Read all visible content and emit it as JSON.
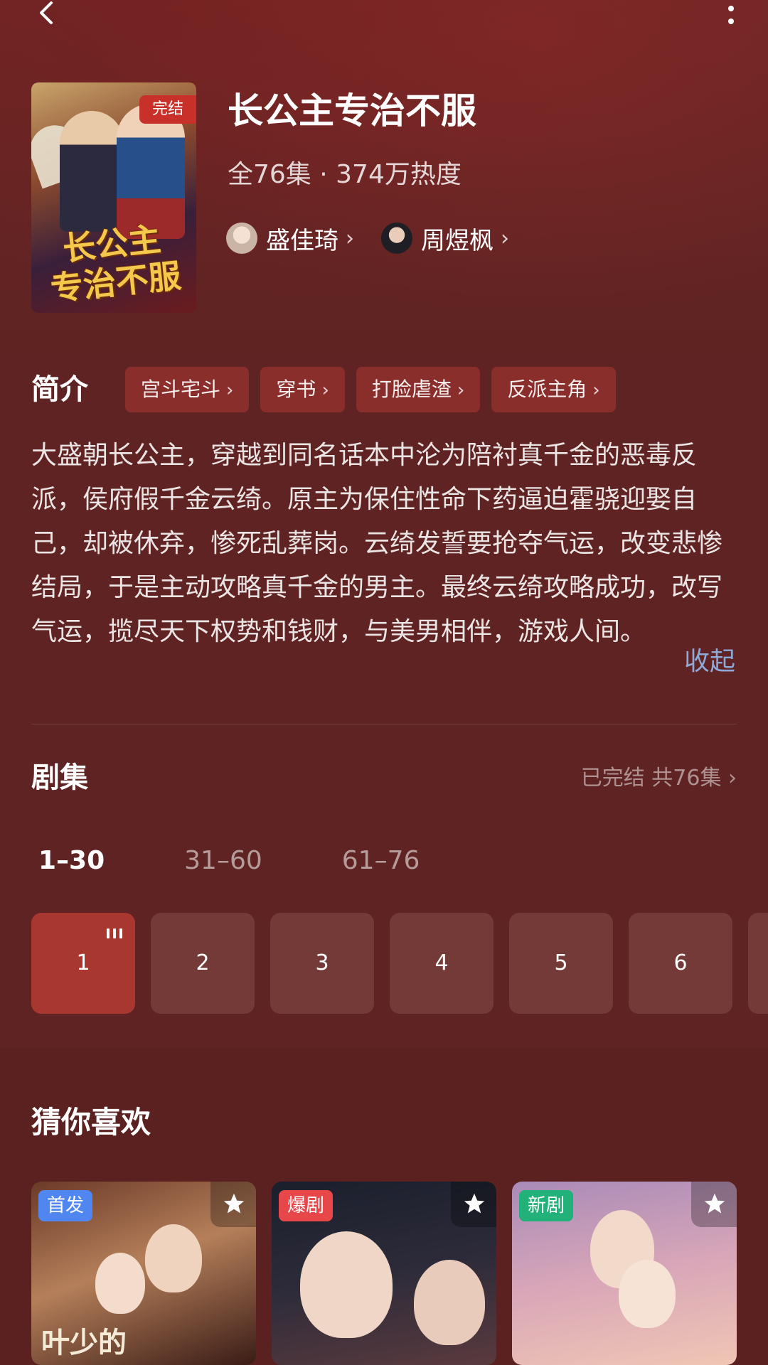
{
  "drama": {
    "title": "长公主专治不服",
    "meta": "全76集 · 374万热度",
    "poster_badge": "完结",
    "poster_title_line1": "长公主",
    "poster_title_line2": "专治不服",
    "cast": [
      {
        "name": "盛佳琦"
      },
      {
        "name": "周煜枫"
      }
    ]
  },
  "intro": {
    "heading": "简介",
    "tags": [
      "宫斗宅斗",
      "穿书",
      "打脸虐渣",
      "反派主角"
    ],
    "synopsis": "大盛朝长公主，穿越到同名话本中沦为陪衬真千金的恶毒反派，侯府假千金云绮。原主为保住性命下药逼迫霍骁迎娶自己，却被休弃，惨死乱葬岗。云绮发誓要抢夺气运，改变悲惨结局，于是主动攻略真千金的男主。最终云绮攻略成功，改写气运，揽尽天下权势和钱财，与美男相伴，游戏人间。",
    "collapse_label": "收起"
  },
  "episodes": {
    "heading": "剧集",
    "status": "已完结 共76集",
    "ranges": [
      "1–30",
      "31–60",
      "61–76"
    ],
    "active_range": 0,
    "items": [
      "1",
      "2",
      "3",
      "4",
      "5",
      "6"
    ],
    "active_episode": 0
  },
  "recommend": {
    "heading": "猜你喜欢",
    "cards": [
      {
        "badge": "首发",
        "badge_color": "#4f86f0",
        "art_text": "叶少的"
      },
      {
        "badge": "爆剧",
        "badge_color": "#e8474a"
      },
      {
        "badge": "新剧",
        "badge_color": "#22b178"
      }
    ]
  },
  "colors": {
    "background": "#5e2322",
    "accent": "#a8372f",
    "tag_bg": "#8a2e2c",
    "link": "#8ea9d8"
  },
  "icons": {
    "back": "chevron-left-icon",
    "more": "more-vertical-icon",
    "favorite": "star-icon",
    "playing": "equalizer-icon"
  }
}
